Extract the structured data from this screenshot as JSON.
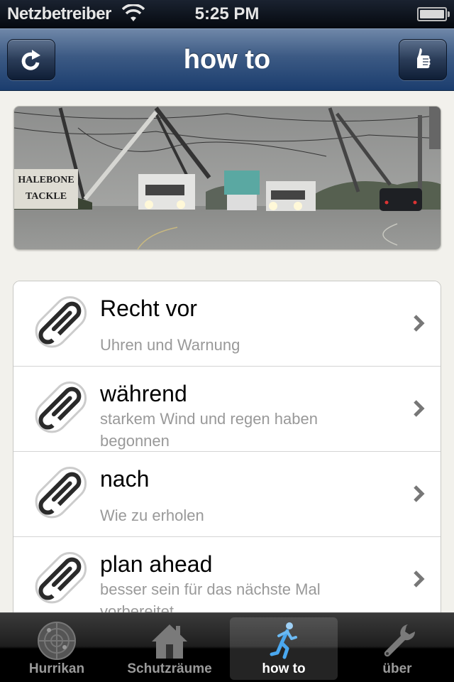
{
  "status_bar": {
    "carrier": "Netzbetreiber",
    "time": "5:25 PM",
    "battery_level": 1.0
  },
  "nav_bar": {
    "title": "how to",
    "left_button_icon": "refresh-icon",
    "right_button_icon": "thumbs-up-icon"
  },
  "hero_image": {
    "description": "Storm scene with utility trucks on a rainy road, leaning power poles",
    "sign_text_1": "HALEBONE",
    "sign_text_2": "TACKLE",
    "sign_small": "Whalebone Tackle"
  },
  "list": {
    "items": [
      {
        "title": "Recht vor",
        "subtitle": "Uhren und Warnung",
        "icon": "paperclip-icon"
      },
      {
        "title": "während",
        "subtitle": "starkem Wind und regen haben begonnen",
        "icon": "paperclip-icon"
      },
      {
        "title": "nach",
        "subtitle": "Wie zu erholen",
        "icon": "paperclip-icon"
      },
      {
        "title": "plan ahead",
        "subtitle": "besser sein für das nächste Mal vorbereitet",
        "icon": "paperclip-icon"
      }
    ]
  },
  "tab_bar": {
    "tabs": [
      {
        "label": "Hurrikan",
        "icon": "radar-icon",
        "active": false
      },
      {
        "label": "Schutzräume",
        "icon": "house-icon",
        "active": false
      },
      {
        "label": "how to",
        "icon": "running-man-icon",
        "active": true
      },
      {
        "label": "über",
        "icon": "wrench-icon",
        "active": false
      }
    ],
    "active_color": "#4aa8f0"
  }
}
